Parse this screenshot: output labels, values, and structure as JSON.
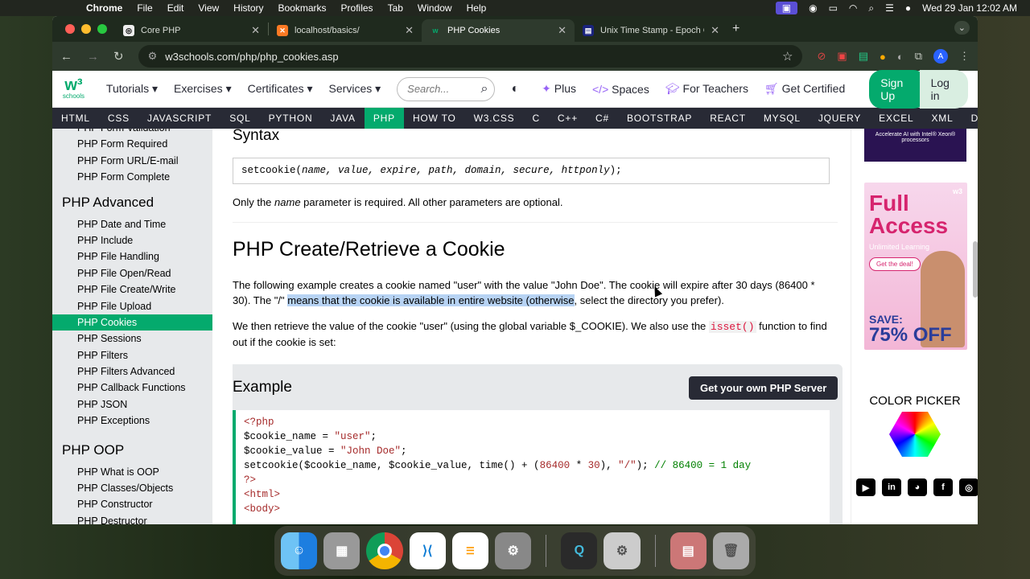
{
  "menubar": {
    "app": "Chrome",
    "items": [
      "File",
      "Edit",
      "View",
      "History",
      "Bookmarks",
      "Profiles",
      "Tab",
      "Window",
      "Help"
    ],
    "datetime": "Wed 29 Jan  12:02 AM"
  },
  "tabs": [
    {
      "title": "Core PHP",
      "icon": "github-icon"
    },
    {
      "title": "localhost/basics/",
      "icon": "xampp-icon"
    },
    {
      "title": "PHP Cookies",
      "icon": "w3schools-icon"
    },
    {
      "title": "Unix Time Stamp - Epoch Co",
      "icon": "epoch-icon"
    }
  ],
  "address": {
    "url": "w3schools.com/php/php_cookies.asp"
  },
  "w3nav": {
    "logo_sub": "schools",
    "items": [
      "Tutorials ▾",
      "Exercises ▾",
      "Certificates ▾",
      "Services ▾"
    ],
    "search_placeholder": "Search...",
    "plus": "Plus",
    "spaces": "Spaces",
    "teachers": "For Teachers",
    "certified": "Get Certified",
    "signup": "Sign Up",
    "login": "Log in"
  },
  "topics": [
    "HTML",
    "CSS",
    "JAVASCRIPT",
    "SQL",
    "PYTHON",
    "JAVA",
    "PHP",
    "HOW TO",
    "W3.CSS",
    "C",
    "C++",
    "C#",
    "BOOTSTRAP",
    "REACT",
    "MYSQL",
    "JQUERY",
    "EXCEL",
    "XML",
    "DJANGO"
  ],
  "sidebar": {
    "top_items": [
      "PHP Form Validation",
      "PHP Form Required",
      "PHP Form URL/E-mail",
      "PHP Form Complete"
    ],
    "advanced_heading": "PHP Advanced",
    "advanced_items": [
      "PHP Date and Time",
      "PHP Include",
      "PHP File Handling",
      "PHP File Open/Read",
      "PHP File Create/Write",
      "PHP File Upload",
      "PHP Cookies",
      "PHP Sessions",
      "PHP Filters",
      "PHP Filters Advanced",
      "PHP Callback Functions",
      "PHP JSON",
      "PHP Exceptions"
    ],
    "oop_heading": "PHP OOP",
    "oop_items": [
      "PHP What is OOP",
      "PHP Classes/Objects",
      "PHP Constructor",
      "PHP Destructor"
    ]
  },
  "content": {
    "syntax_heading": "Syntax",
    "syntax_code_fn": "setcookie(",
    "syntax_code_params": "name, value, expire, path, domain, secure, httponly",
    "syntax_code_end": ");",
    "only_pre": "Only the ",
    "only_name": "name",
    "only_post": " parameter is required. All other parameters are optional.",
    "h2": "PHP Create/Retrieve a Cookie",
    "para1_a": "The following example creates a cookie named \"user\" with the value \"John Doe\". The cookie will expire after 30 days (86400 * 30). The \"/\" ",
    "para1_hl": "means that the cookie is available in entire website (otherwise",
    "para1_b": ", select the directory you prefer).",
    "para2_a": "We then retrieve the value of the cookie \"user\" (using the global variable $_COOKIE). We also use the ",
    "para2_kw": "isset()",
    "para2_b": " function to find out if the cookie is set:",
    "example_heading": "Example",
    "example_button": "Get your own PHP Server",
    "code": {
      "l1": "<?php",
      "l2a": "$cookie_name = ",
      "l2s": "\"user\"",
      "l2e": ";",
      "l3a": "$cookie_value = ",
      "l3s": "\"John Doe\"",
      "l3e": ";",
      "l4a": "setcookie($cookie_name, $cookie_value, time() + (",
      "l4n1": "86400",
      "l4m": " * ",
      "l4n2": "30",
      "l4b": "), ",
      "l4s": "\"/\"",
      "l4c": "); ",
      "l4cm": "// 86400 = 1 day",
      "l5": "?>",
      "l6": "<html>",
      "l7": "<body>"
    }
  },
  "ads": {
    "ad1_text": "Accelerate AI with Intel® Xeon® processors",
    "full": "Full",
    "access": "Access",
    "unlimited": "Unlimited Learning",
    "deal": "Get the deal!",
    "save": "SAVE:",
    "off": "75% OFF",
    "w3": "w3",
    "color_picker": "COLOR PICKER"
  },
  "colors": {
    "accent": "#04aa6d",
    "topbar": "#282a35"
  }
}
